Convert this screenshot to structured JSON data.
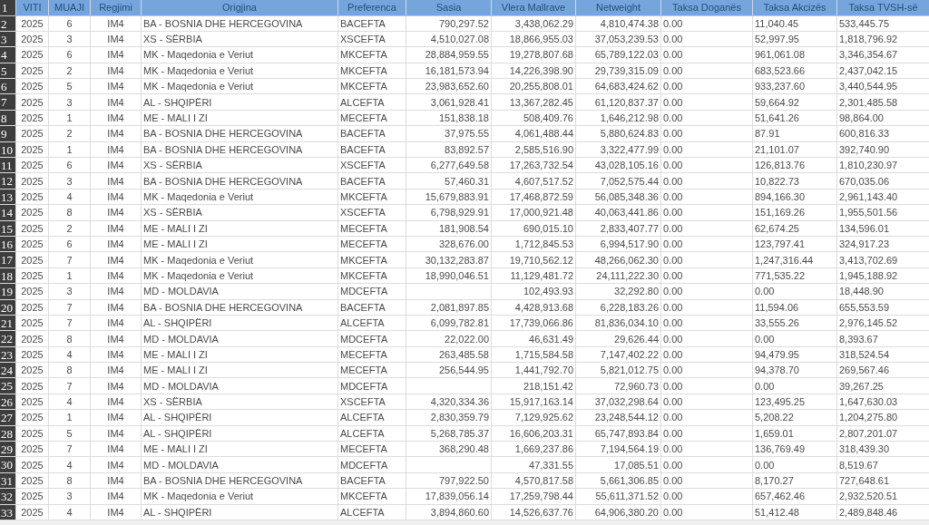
{
  "header": {
    "row_number": "1",
    "columns": [
      "VITI",
      "MUAJI",
      "Regjimi",
      "Origjina",
      "Preferenca",
      "Sasia",
      "Vlera Mallrave",
      "Netweight",
      "Taksa Doganës",
      "Taksa Akcizës",
      "Taksa TVSH-së"
    ]
  },
  "rows": [
    {
      "row_number": "2",
      "cells": [
        "2025",
        "6",
        "IM4",
        "BA - BOSNIA DHE HERCEGOVINA",
        "BACEFTA",
        "790,297.52",
        "3,438,062.29",
        "4,810,474.38",
        "0.00",
        "11,040.45",
        "533,445.75"
      ]
    },
    {
      "row_number": "3",
      "cells": [
        "2025",
        "3",
        "IM4",
        "XS - SËRBIA",
        "XSCEFTA",
        "4,510,027.08",
        "18,866,955.03",
        "37,053,239.53",
        "0.00",
        "52,997.95",
        "1,818,796.92"
      ]
    },
    {
      "row_number": "4",
      "cells": [
        "2025",
        "6",
        "IM4",
        "MK - Maqedonia e Veriut",
        "MKCEFTA",
        "28,884,959.55",
        "19,278,807.68",
        "65,789,122.03",
        "0.00",
        "961,061.08",
        "3,346,354.67"
      ]
    },
    {
      "row_number": "5",
      "cells": [
        "2025",
        "2",
        "IM4",
        "MK - Maqedonia e Veriut",
        "MKCEFTA",
        "16,181,573.94",
        "14,226,398.90",
        "29,739,315.09",
        "0.00",
        "683,523.66",
        "2,437,042.15"
      ]
    },
    {
      "row_number": "6",
      "cells": [
        "2025",
        "5",
        "IM4",
        "MK - Maqedonia e Veriut",
        "MKCEFTA",
        "23,983,652.60",
        "20,255,808.01",
        "64,683,424.62",
        "0.00",
        "933,237.60",
        "3,440,544.95"
      ]
    },
    {
      "row_number": "7",
      "cells": [
        "2025",
        "3",
        "IM4",
        "AL - SHQIPËRI",
        "ALCEFTA",
        "3,061,928.41",
        "13,367,282.45",
        "61,120,837.37",
        "0.00",
        "59,664.92",
        "2,301,485.58"
      ]
    },
    {
      "row_number": "8",
      "cells": [
        "2025",
        "1",
        "IM4",
        "ME - MALI I ZI",
        "MECEFTA",
        "151,838.18",
        "508,409.76",
        "1,646,212.98",
        "0.00",
        "51,641.26",
        "98,864.00"
      ]
    },
    {
      "row_number": "9",
      "cells": [
        "2025",
        "2",
        "IM4",
        "BA - BOSNIA DHE HERCEGOVINA",
        "BACEFTA",
        "37,975.55",
        "4,061,488.44",
        "5,880,624.83",
        "0.00",
        "87.91",
        "600,816.33"
      ]
    },
    {
      "row_number": "10",
      "cells": [
        "2025",
        "1",
        "IM4",
        "BA - BOSNIA DHE HERCEGOVINA",
        "BACEFTA",
        "83,892.57",
        "2,585,516.90",
        "3,322,477.99",
        "0.00",
        "21,101.07",
        "392,740.90"
      ]
    },
    {
      "row_number": "11",
      "cells": [
        "2025",
        "6",
        "IM4",
        "XS - SËRBIA",
        "XSCEFTA",
        "6,277,649.58",
        "17,263,732.54",
        "43,028,105.16",
        "0.00",
        "126,813.76",
        "1,810,230.97"
      ]
    },
    {
      "row_number": "12",
      "cells": [
        "2025",
        "3",
        "IM4",
        "BA - BOSNIA DHE HERCEGOVINA",
        "BACEFTA",
        "57,460.31",
        "4,607,517.52",
        "7,052,575.44",
        "0.00",
        "10,822.73",
        "670,035.06"
      ]
    },
    {
      "row_number": "13",
      "cells": [
        "2025",
        "4",
        "IM4",
        "MK - Maqedonia e Veriut",
        "MKCEFTA",
        "15,679,883.91",
        "17,468,872.59",
        "56,085,348.36",
        "0.00",
        "894,166.30",
        "2,961,143.40"
      ]
    },
    {
      "row_number": "14",
      "cells": [
        "2025",
        "8",
        "IM4",
        "XS - SËRBIA",
        "XSCEFTA",
        "6,798,929.91",
        "17,000,921.48",
        "40,063,441.86",
        "0.00",
        "151,169.26",
        "1,955,501.56"
      ]
    },
    {
      "row_number": "15",
      "cells": [
        "2025",
        "2",
        "IM4",
        "ME - MALI I ZI",
        "MECEFTA",
        "181,908.54",
        "690,015.10",
        "2,833,407.77",
        "0.00",
        "62,674.25",
        "134,596.01"
      ]
    },
    {
      "row_number": "16",
      "cells": [
        "2025",
        "6",
        "IM4",
        "ME - MALI I ZI",
        "MECEFTA",
        "328,676.00",
        "1,712,845.53",
        "6,994,517.90",
        "0.00",
        "123,797.41",
        "324,917.23"
      ]
    },
    {
      "row_number": "17",
      "cells": [
        "2025",
        "7",
        "IM4",
        "MK - Maqedonia e Veriut",
        "MKCEFTA",
        "30,132,283.87",
        "19,710,562.12",
        "48,266,062.30",
        "0.00",
        "1,247,316.44",
        "3,413,702.69"
      ]
    },
    {
      "row_number": "18",
      "cells": [
        "2025",
        "1",
        "IM4",
        "MK - Maqedonia e Veriut",
        "MKCEFTA",
        "18,990,046.51",
        "11,129,481.72",
        "24,111,222.30",
        "0.00",
        "771,535.22",
        "1,945,188.92"
      ]
    },
    {
      "row_number": "19",
      "cells": [
        "2025",
        "3",
        "IM4",
        "MD - MOLDAVIA",
        "MDCEFTA",
        null,
        "102,493.93",
        "32,292.80",
        "0.00",
        "0.00",
        "18,448.90"
      ]
    },
    {
      "row_number": "20",
      "cells": [
        "2025",
        "7",
        "IM4",
        "BA - BOSNIA DHE HERCEGOVINA",
        "BACEFTA",
        "2,081,897.85",
        "4,428,913.68",
        "6,228,183.26",
        "0.00",
        "11,594.06",
        "655,553.59"
      ]
    },
    {
      "row_number": "21",
      "cells": [
        "2025",
        "7",
        "IM4",
        "AL - SHQIPËRI",
        "ALCEFTA",
        "6,099,782.81",
        "17,739,066.86",
        "81,836,034.10",
        "0.00",
        "33,555.26",
        "2,976,145.52"
      ]
    },
    {
      "row_number": "22",
      "cells": [
        "2025",
        "8",
        "IM4",
        "MD - MOLDAVIA",
        "MDCEFTA",
        "22,022.00",
        "46,631.49",
        "29,626.44",
        "0.00",
        "0.00",
        "8,393.67"
      ]
    },
    {
      "row_number": "23",
      "cells": [
        "2025",
        "4",
        "IM4",
        "ME - MALI I ZI",
        "MECEFTA",
        "263,485.58",
        "1,715,584.58",
        "7,147,402.22",
        "0.00",
        "94,479.95",
        "318,524.54"
      ]
    },
    {
      "row_number": "24",
      "cells": [
        "2025",
        "8",
        "IM4",
        "ME - MALI I ZI",
        "MECEFTA",
        "256,544.95",
        "1,441,792.70",
        "5,821,012.75",
        "0.00",
        "94,378.70",
        "269,567.46"
      ]
    },
    {
      "row_number": "25",
      "cells": [
        "2025",
        "7",
        "IM4",
        "MD - MOLDAVIA",
        "MDCEFTA",
        null,
        "218,151.42",
        "72,960.73",
        "0.00",
        "0.00",
        "39,267.25"
      ]
    },
    {
      "row_number": "26",
      "cells": [
        "2025",
        "4",
        "IM4",
        "XS - SËRBIA",
        "XSCEFTA",
        "4,320,334.36",
        "15,917,163.14",
        "37,032,298.64",
        "0.00",
        "123,495.25",
        "1,647,630.03"
      ]
    },
    {
      "row_number": "27",
      "cells": [
        "2025",
        "1",
        "IM4",
        "AL - SHQIPËRI",
        "ALCEFTA",
        "2,830,359.79",
        "7,129,925.62",
        "23,248,544.12",
        "0.00",
        "5,208.22",
        "1,204,275.80"
      ]
    },
    {
      "row_number": "28",
      "cells": [
        "2025",
        "5",
        "IM4",
        "AL - SHQIPËRI",
        "ALCEFTA",
        "5,268,785.37",
        "16,606,203.31",
        "65,747,893.84",
        "0.00",
        "1,659.01",
        "2,807,201.07"
      ]
    },
    {
      "row_number": "29",
      "cells": [
        "2025",
        "7",
        "IM4",
        "ME - MALI I ZI",
        "MECEFTA",
        "368,290.48",
        "1,669,237.86",
        "7,194,564.19",
        "0.00",
        "136,769.49",
        "318,439.30"
      ]
    },
    {
      "row_number": "30",
      "cells": [
        "2025",
        "4",
        "IM4",
        "MD - MOLDAVIA",
        "MDCEFTA",
        null,
        "47,331.55",
        "17,085.51",
        "0.00",
        "0.00",
        "8,519.67"
      ]
    },
    {
      "row_number": "31",
      "cells": [
        "2025",
        "8",
        "IM4",
        "BA - BOSNIA DHE HERCEGOVINA",
        "BACEFTA",
        "797,922.50",
        "4,570,817.58",
        "5,661,306.85",
        "0.00",
        "8,170.27",
        "727,648.61"
      ]
    },
    {
      "row_number": "32",
      "cells": [
        "2025",
        "3",
        "IM4",
        "MK - Maqedonia e Veriut",
        "MKCEFTA",
        "17,839,056.14",
        "17,259,798.44",
        "55,611,371.52",
        "0.00",
        "657,462.46",
        "2,932,520.51"
      ]
    },
    {
      "row_number": "33",
      "cells": [
        "2025",
        "4",
        "IM4",
        "AL - SHQIPËRI",
        "ALCEFTA",
        "3,894,860.60",
        "14,526,637.76",
        "64,906,380.20",
        "0.00",
        "51,412.48",
        "2,489,848.46"
      ]
    }
  ]
}
